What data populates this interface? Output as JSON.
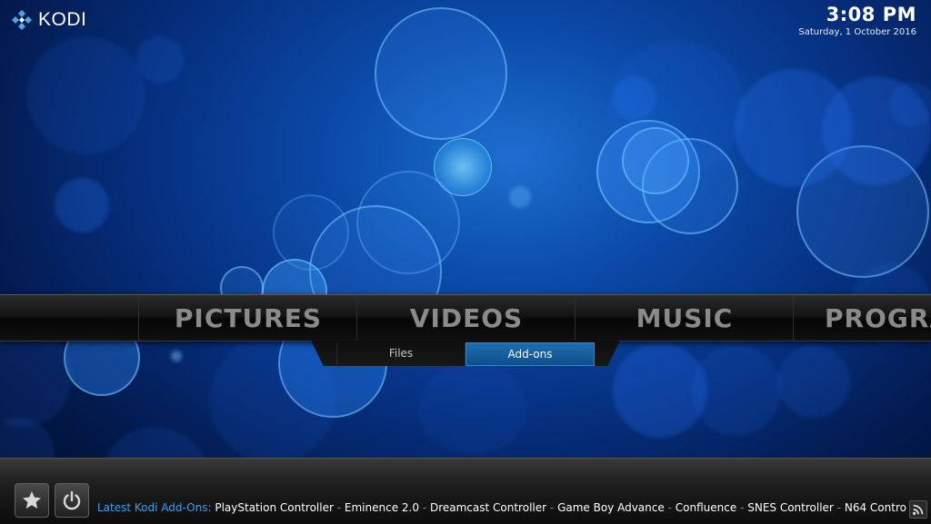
{
  "app": {
    "name": "KODI"
  },
  "clock": {
    "time": "3:08 PM",
    "date": "Saturday, 1 October 2016"
  },
  "main_menu": {
    "items": [
      {
        "label": "PICTURES"
      },
      {
        "label": "VIDEOS"
      },
      {
        "label": "MUSIC"
      },
      {
        "label": "PROGRA"
      }
    ]
  },
  "sub_menu": {
    "items": [
      {
        "label": "Files",
        "selected": false
      },
      {
        "label": "Add-ons",
        "selected": true
      }
    ]
  },
  "footer": {
    "buttons": [
      {
        "icon": "star-icon"
      },
      {
        "icon": "power-icon"
      }
    ],
    "ticker": {
      "label": "Latest Kodi Add-Ons:",
      "items": [
        "PlayStation Controller",
        "Eminence 2.0",
        "Dreamcast Controller",
        "Game Boy Advance",
        "Confluence",
        "SNES Controller",
        "N64 Contro"
      ],
      "separator": "-"
    },
    "rss_icon": "rss-icon"
  },
  "colors": {
    "accent": "#3aa0f0",
    "selected_tab": "#1f6eb0",
    "menu_text": "#8a8a8a"
  }
}
